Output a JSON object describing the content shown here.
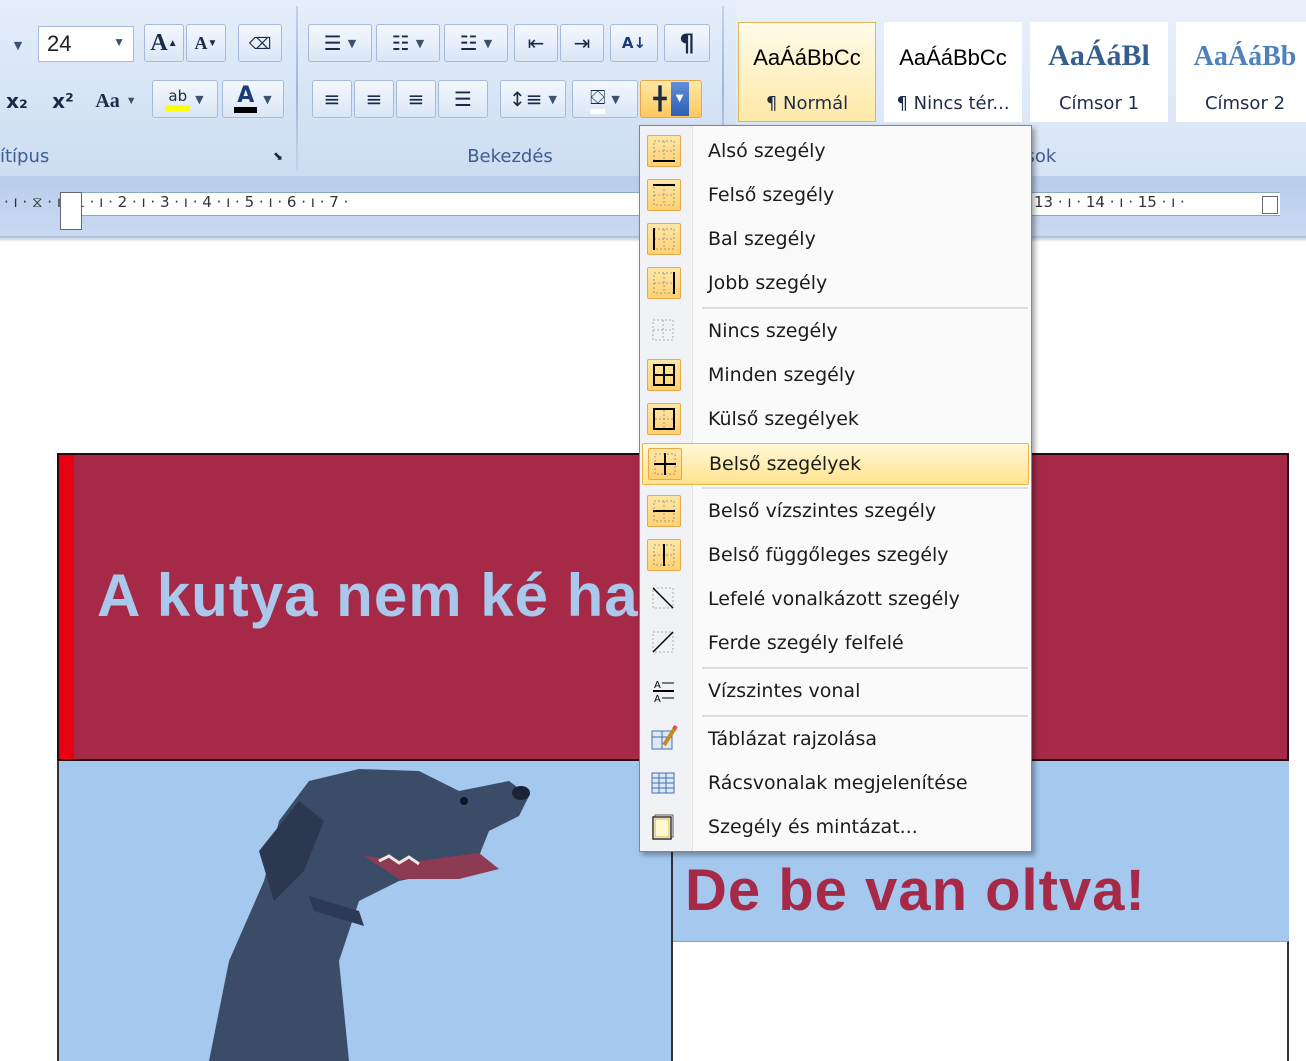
{
  "ribbon": {
    "font_size_value": "24",
    "groups": {
      "font_label": "ítípus",
      "paragraph_label": "Bekezdés",
      "styles_label": "Stílusok"
    },
    "styles": [
      {
        "sample": "AaÁáBbCc",
        "name": "¶ Normál",
        "selected": true
      },
      {
        "sample": "AaÁáBbCc",
        "name": "¶ Nincs tér...",
        "selected": false
      },
      {
        "sample": "AaÁáBl",
        "name": "Címsor 1",
        "selected": false
      },
      {
        "sample": "AaÁáBb",
        "name": "Címsor 2",
        "selected": false
      }
    ],
    "text": {
      "font_grow": "A",
      "font_shrink": "A",
      "subscript": "x₂",
      "superscript": "x²",
      "change_case": "Aa",
      "highlight": "ab",
      "font_color": "A",
      "sort": "A↓",
      "pilcrow": "¶"
    }
  },
  "ruler": {
    "left_text": "· ı · ⧖ · ı · 1 · ı · 2 · ı · 3 · ı · 4 · ı · 5 · ı · 6 · ı · 7 ·",
    "right_text": "13 · ı · 14 · ı · 15 · ı ·"
  },
  "document": {
    "headline": "A kutya nem ké                    harap.",
    "subhead": "De be van oltva!"
  },
  "border_menu": {
    "items": [
      {
        "label": "Alsó szegély",
        "icon": "bottom-border-icon",
        "boxed": true
      },
      {
        "label": "Felső szegély",
        "icon": "top-border-icon",
        "boxed": true
      },
      {
        "label": "Bal szegély",
        "icon": "left-border-icon",
        "boxed": true
      },
      {
        "label": "Jobb szegély",
        "icon": "right-border-icon",
        "boxed": true
      },
      {
        "label": "Nincs szegély",
        "icon": "no-border-icon",
        "boxed": false
      },
      {
        "label": "Minden szegély",
        "icon": "all-borders-icon",
        "boxed": true
      },
      {
        "label": "Külső szegélyek",
        "icon": "outside-borders-icon",
        "boxed": true
      },
      {
        "label": "Belső szegélyek",
        "icon": "inside-borders-icon",
        "boxed": true,
        "highlighted": true
      },
      {
        "label": "Belső vízszintes szegély",
        "icon": "inside-horizontal-border-icon",
        "boxed": true
      },
      {
        "label": "Belső függőleges szegély",
        "icon": "inside-vertical-border-icon",
        "boxed": true
      },
      {
        "label": "Lefelé vonalkázott szegély",
        "icon": "diagonal-down-border-icon",
        "boxed": false
      },
      {
        "label": "Ferde szegély felfelé",
        "icon": "diagonal-up-border-icon",
        "boxed": false
      },
      {
        "label": "Vízszintes vonal",
        "icon": "horizontal-line-icon",
        "boxed": false
      },
      {
        "label": "Táblázat rajzolása",
        "icon": "draw-table-icon",
        "boxed": false
      },
      {
        "label": "Rácsvonalak megjelenítése",
        "icon": "view-gridlines-icon",
        "boxed": false
      },
      {
        "label": "Szegély és mintázat...",
        "icon": "borders-and-shading-icon",
        "boxed": false
      }
    ]
  },
  "colors": {
    "header_cell": "#a62a48",
    "headline_text": "#a9c8ec",
    "light_cell": "#a5c8ee",
    "menu_highlight": "#ffe48e",
    "accent_red": "#e60012"
  }
}
